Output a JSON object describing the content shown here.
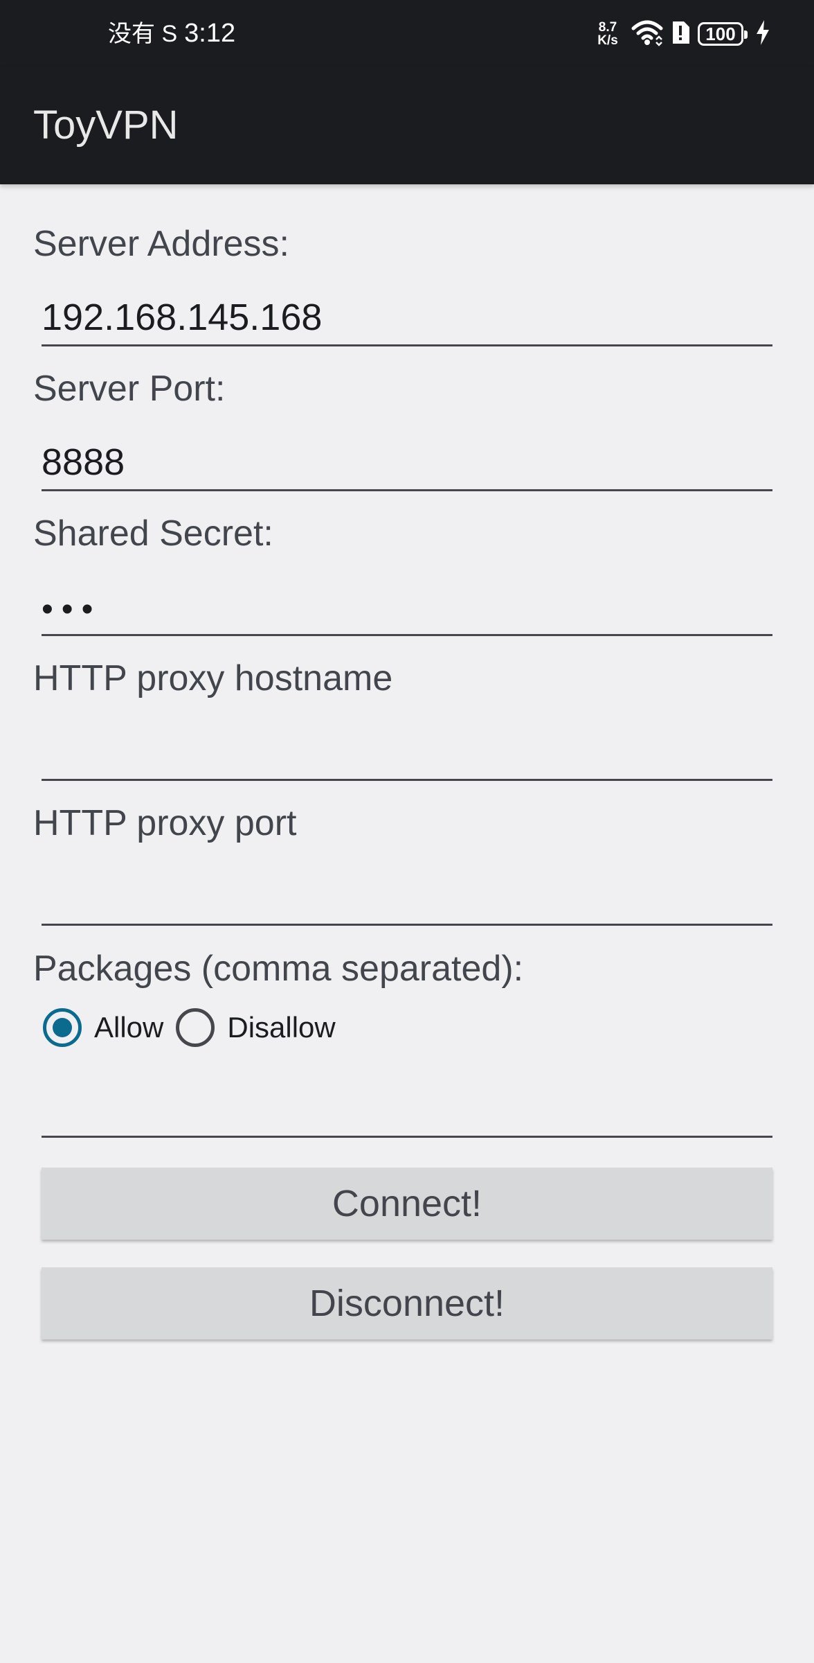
{
  "status_bar": {
    "carrier": "没有 S",
    "time": "3:12",
    "net_speed_value": "8.7",
    "net_speed_unit": "K/s",
    "battery_level": "100",
    "icons": [
      "wifi-icon",
      "alert-sim-icon",
      "battery-icon",
      "charging-icon"
    ]
  },
  "app_bar": {
    "title": "ToyVPN"
  },
  "form": {
    "server_address_label": "Server Address:",
    "server_address_value": "192.168.145.168",
    "server_port_label": "Server Port:",
    "server_port_value": "8888",
    "shared_secret_label": "Shared Secret:",
    "shared_secret_masked": "•••",
    "proxy_host_label": "HTTP proxy hostname",
    "proxy_host_value": "",
    "proxy_port_label": "HTTP proxy port",
    "proxy_port_value": "",
    "packages_label": "Packages (comma separated):",
    "packages_value": "",
    "mode_options": [
      {
        "label": "Allow",
        "selected": true
      },
      {
        "label": "Disallow",
        "selected": false
      }
    ]
  },
  "buttons": {
    "connect_label": "Connect!",
    "disconnect_label": "Disconnect!"
  },
  "colors": {
    "bar_background": "#1a1c1f",
    "page_background": "#f0f0f2",
    "accent": "#0b6b8f",
    "button_background": "#d7d8d9"
  }
}
